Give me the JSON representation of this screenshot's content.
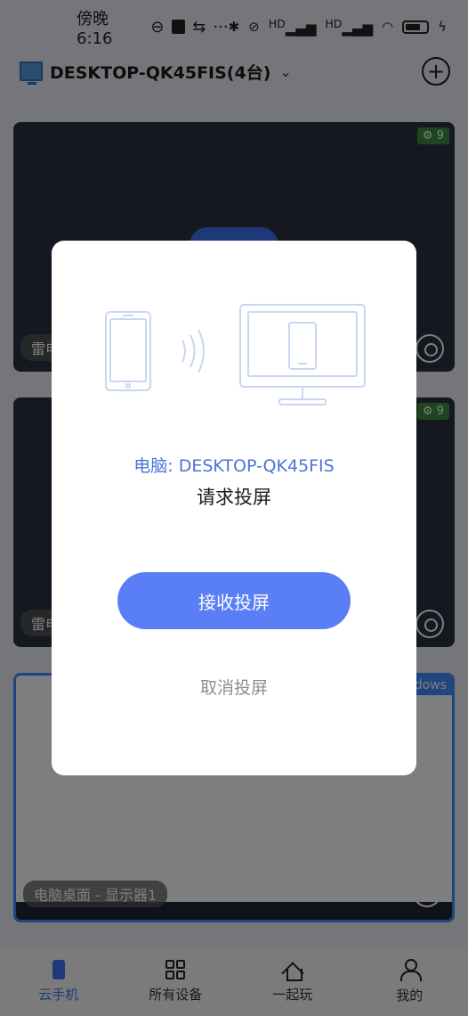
{
  "status_bar": {
    "time": "傍晚6:16",
    "sim_icon": "sim-icon",
    "extra": "···",
    "signal_labels": [
      "HD",
      "HD"
    ]
  },
  "header": {
    "title": "DESKTOP-QK45FIS(4台)"
  },
  "cards": [
    {
      "badge": "9",
      "label": "雷电"
    },
    {
      "badge": "9",
      "label": "雷电"
    },
    {
      "tag": "ndows",
      "label": "电脑桌面 - 显示器1"
    }
  ],
  "dialog": {
    "device_line": "电脑: DESKTOP-QK45FIS",
    "message": "请求投屏",
    "accept_label": "接收投屏",
    "cancel_label": "取消投屏"
  },
  "bottom_nav": {
    "items": [
      {
        "label": "云手机",
        "icon": "phone-icon",
        "active": true
      },
      {
        "label": "所有设备",
        "icon": "grid-icon",
        "active": false
      },
      {
        "label": "一起玩",
        "icon": "home-icon",
        "active": false
      },
      {
        "label": "我的",
        "icon": "user-icon",
        "active": false
      }
    ]
  },
  "colors": {
    "accent": "#5a7ef5",
    "device_text": "#4a74d6",
    "cancel_text": "#8a9099",
    "badge_green": "#3c8a3f"
  }
}
